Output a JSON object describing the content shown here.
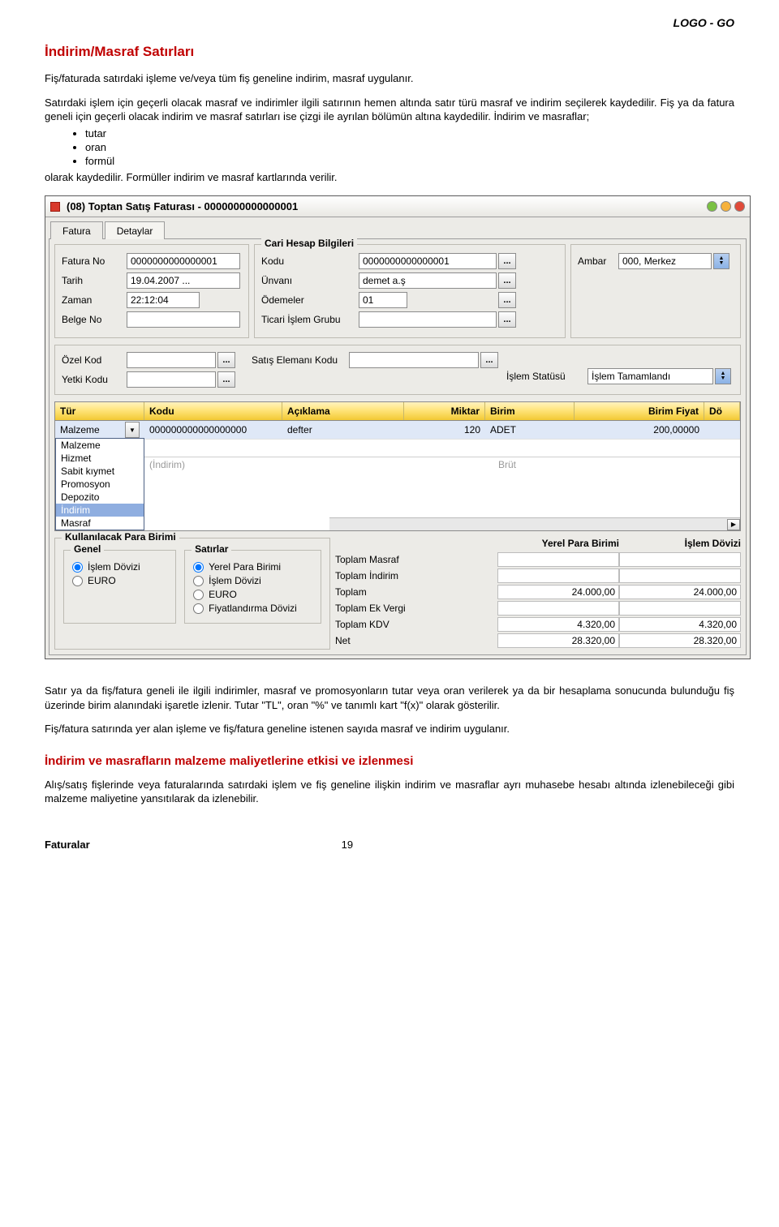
{
  "brand": "LOGO - GO",
  "heading": "İndirim/Masraf Satırları",
  "intro": "Fiş/faturada satırdaki işleme ve/veya tüm fiş geneline indirim, masraf uygulanır.",
  "para2": "Satırdaki işlem için geçerli olacak masraf ve indirimler ilgili satırının hemen altında satır türü masraf ve indirim seçilerek kaydedilir. Fiş ya da fatura geneli için geçerli olacak indirim ve masraf satırları ise çizgi ile ayrılan bölümün altına kaydedilir. İndirim ve masraflar;",
  "bullets": [
    "tutar",
    "oran",
    "formül"
  ],
  "para2b": "olarak kaydedilir. Formüller indirim ve masraf kartlarında verilir.",
  "win_title": "(08) Toptan Satış Faturası - 0000000000000001",
  "tabs": {
    "fatura": "Fatura",
    "detaylar": "Detaylar"
  },
  "left": {
    "fatura_no_l": "Fatura No",
    "fatura_no": "0000000000000001",
    "tarih_l": "Tarih",
    "tarih": "19.04.2007 ...",
    "zaman_l": "Zaman",
    "zaman": "22:12:04",
    "belge_l": "Belge No",
    "belge": ""
  },
  "cari": {
    "legend": "Cari Hesap Bilgileri",
    "kodu_l": "Kodu",
    "kodu": "0000000000000001",
    "unvani_l": "Ünvanı",
    "unvani": "demet a.ş",
    "odemeler_l": "Ödemeler",
    "odemeler": "01",
    "tig_l": "Ticari İşlem Grubu",
    "tig": ""
  },
  "ambar_l": "Ambar",
  "ambar": "000, Merkez",
  "mid": {
    "ozel_l": "Özel Kod",
    "yetki_l": "Yetki Kodu",
    "satis_l": "Satış Elemanı Kodu",
    "status_l": "İşlem Statüsü",
    "status_v": "İşlem Tamamlandı"
  },
  "grid": {
    "h_tur": "Tür",
    "h_kodu": "Kodu",
    "h_ack": "Açıklama",
    "h_mik": "Miktar",
    "h_bir": "Birim",
    "h_bf": "Birim Fiyat",
    "h_do": "Dö",
    "r_tur": "Malzeme",
    "r_kodu": "000000000000000000",
    "r_ack": "defter",
    "r_mik": "120",
    "r_bir": "ADET",
    "r_bf": "200,00000",
    "hint_l": "(İndirim)",
    "hint_r": "Brüt",
    "opts": [
      "Malzeme",
      "Hizmet",
      "Sabit kıymet",
      "Promosyon",
      "Depozito",
      "İndirim",
      "Masraf"
    ]
  },
  "bottom": {
    "kpb_legend": "Kullanılacak Para Birimi",
    "genel_legend": "Genel",
    "satirlar_legend": "Satırlar",
    "genel_opts": [
      "İşlem Dövizi",
      "EURO"
    ],
    "satirlar_opts": [
      "Yerel Para Birimi",
      "İşlem Dövizi",
      "EURO",
      "Fiyatlandırma Dövizi"
    ],
    "th_ypb": "Yerel Para Birimi",
    "th_id": "İşlem Dövizi",
    "rows": [
      {
        "l": "Toplam Masraf",
        "a": "",
        "b": ""
      },
      {
        "l": "Toplam İndirim",
        "a": "",
        "b": ""
      },
      {
        "l": "Toplam",
        "a": "24.000,00",
        "b": "24.000,00"
      },
      {
        "l": "Toplam Ek Vergi",
        "a": "",
        "b": ""
      },
      {
        "l": "Toplam KDV",
        "a": "4.320,00",
        "b": "4.320,00"
      },
      {
        "l": "Net",
        "a": "28.320,00",
        "b": "28.320,00"
      }
    ]
  },
  "after1": "Satır ya da fiş/fatura geneli ile ilgili indirimler, masraf ve promosyonların tutar veya oran verilerek ya da bir hesaplama sonucunda bulunduğu fiş üzerinde birim alanındaki işaretle izlenir. Tutar \"TL\", oran \"%\" ve tanımlı kart \"f(x)\" olarak gösterilir.",
  "after2": "Fiş/fatura satırında yer alan işleme ve fiş/fatura geneline istenen sayıda masraf ve indirim uygulanır.",
  "sub_heading": "İndirim ve masrafların malzeme maliyetlerine etkisi ve izlenmesi",
  "subp": "Alış/satış fişlerinde veya faturalarında satırdaki işlem ve fiş geneline ilişkin indirim ve masraflar ayrı muhasebe hesabı altında izlenebileceği gibi malzeme maliyetine yansıtılarak da izlenebilir.",
  "footer_l": "Faturalar",
  "footer_p": "19"
}
